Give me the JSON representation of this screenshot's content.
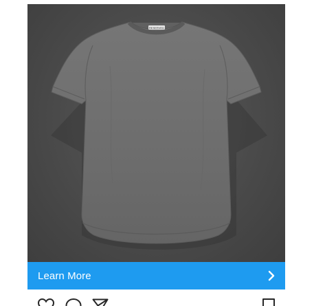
{
  "post": {
    "cta": {
      "label": "Learn More",
      "icon": "chevron-right-icon",
      "background": "#1e9bf0",
      "text_color": "#ffffff"
    },
    "media": {
      "tag_text": "RESERVED",
      "backdrop_color": "#4a4a4a",
      "shirt_color": "#6e6e6e"
    },
    "actions": {
      "like_icon": "heart-icon",
      "comment_icon": "comment-icon",
      "share_icon": "send-icon",
      "save_icon": "bookmark-icon"
    }
  }
}
